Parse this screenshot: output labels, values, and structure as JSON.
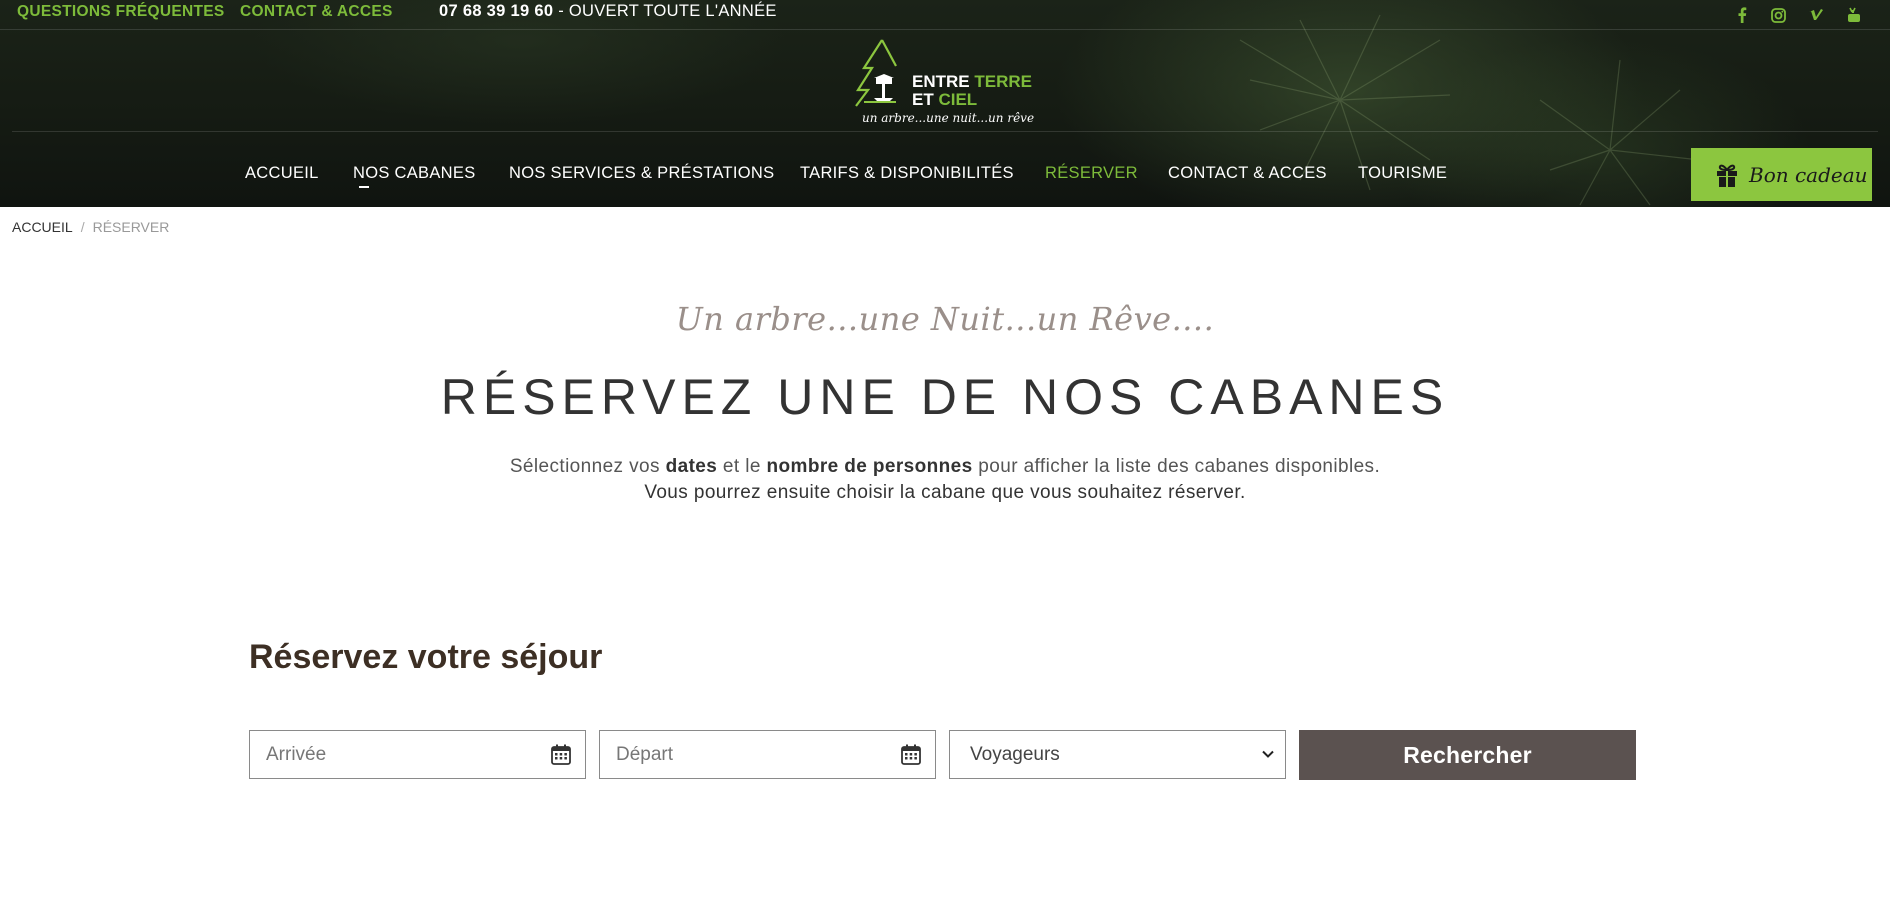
{
  "topbar": {
    "faq_label": "QUESTIONS FRÉQUENTES",
    "contact_label": "CONTACT & ACCES",
    "phone": "07 68 39 19 60",
    "opening": " - OUVERT TOUTE L'ANNÉE",
    "social": [
      "facebook-icon",
      "instagram-icon",
      "vimeo-icon",
      "youtube-icon"
    ]
  },
  "logo": {
    "line1_a": "ENTRE ",
    "line1_b": "TERRE",
    "line2_a": "ET ",
    "line2_b": "CIEL",
    "tagline": "un arbre...une nuit...un rêve"
  },
  "nav": {
    "items": [
      {
        "label": "ACCUEIL"
      },
      {
        "label": "NOS CABANES"
      },
      {
        "label": "NOS SERVICES & PRÉSTATIONS"
      },
      {
        "label": "TARIFS & DISPONIBILITÉS"
      },
      {
        "label": "RÉSERVER"
      },
      {
        "label": "CONTACT & ACCES"
      },
      {
        "label": "TOURISME"
      }
    ],
    "gift_label": "Bon cadeau"
  },
  "breadcrumb": {
    "home": "ACCUEIL",
    "separator": "/",
    "current": "RÉSERVER"
  },
  "intro": {
    "tagline": "Un arbre...une Nuit...un Rêve....",
    "title": "RÉSERVEZ UNE DE NOS CABANES",
    "desc_p1": "Sélectionnez vos ",
    "desc_b1": "dates",
    "desc_p2": " et le ",
    "desc_b2": "nombre de personnes",
    "desc_p3": " pour afficher la liste des cabanes disponibles.",
    "desc_line2": "Vous pourrez ensuite choisir la cabane que vous souhaitez réserver."
  },
  "booking": {
    "title": "Réservez votre séjour",
    "arrival_placeholder": "Arrivée",
    "departure_placeholder": "Départ",
    "travelers_label": "Voyageurs",
    "search_label": "Rechercher"
  },
  "colors": {
    "accent_green": "#7dbb3a",
    "gift_button": "#8cc63f",
    "search_button": "#5b5250"
  }
}
